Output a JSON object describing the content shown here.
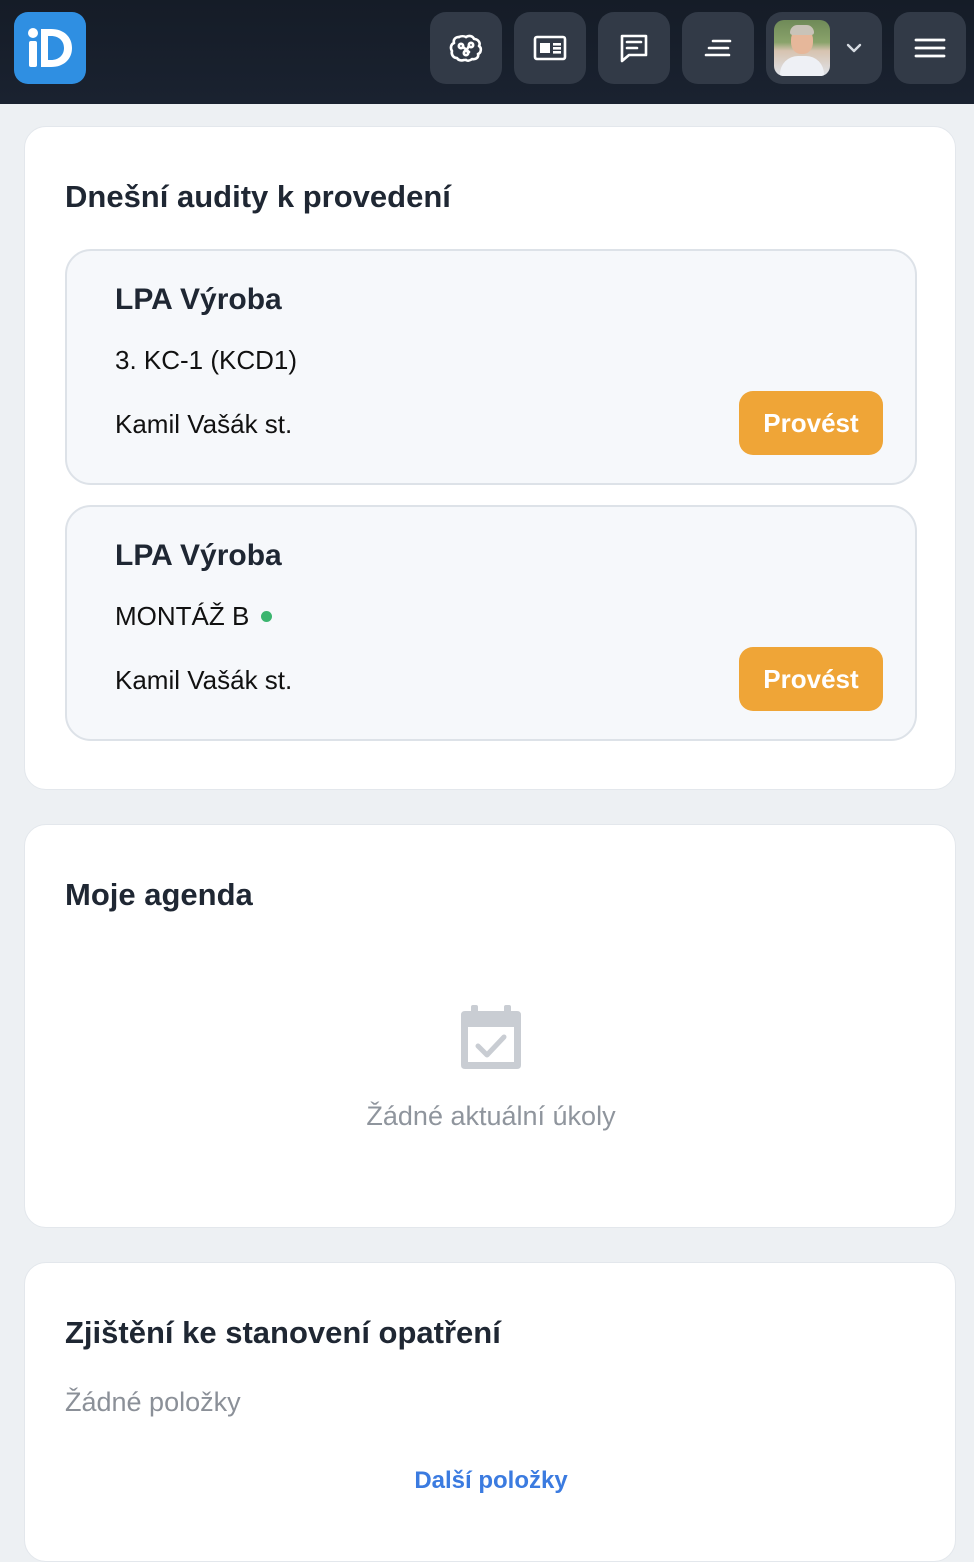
{
  "header": {
    "logo_label": "iD",
    "nav_icons": [
      "brain-icon",
      "newspaper-icon",
      "message-icon",
      "text-lines-icon"
    ],
    "user_menu_icon": "chevron-down-icon",
    "menu_icon": "hamburger-icon"
  },
  "audits_card": {
    "title": "Dnešní audity k provedení",
    "items": [
      {
        "name": "LPA Výroba",
        "place": "3. KC-1 (KCD1)",
        "status_dot": false,
        "auditor": "Kamil Vašák st.",
        "action": "Provést"
      },
      {
        "name": "LPA Výroba",
        "place": "MONTÁŽ B",
        "status_dot": true,
        "auditor": "Kamil Vašák st.",
        "action": "Provést"
      }
    ]
  },
  "agenda_card": {
    "title": "Moje agenda",
    "empty_icon": "calendar-check-icon",
    "empty_text": "Žádné aktuální úkoly"
  },
  "findings_card": {
    "title": "Zjištění ke stanovení opatření",
    "no_items_text": "Žádné položky",
    "more_link": "Další položky"
  },
  "colors": {
    "accent_button": "#efa537",
    "logo_bg": "#2f8fe2",
    "status_dot": "#3bb56f",
    "link": "#3b7be0"
  }
}
